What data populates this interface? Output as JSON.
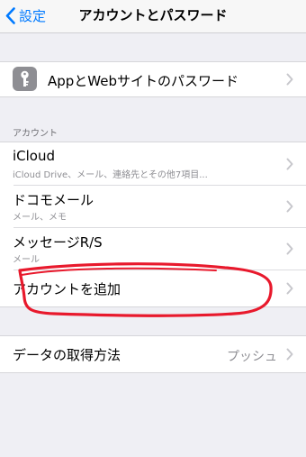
{
  "nav": {
    "back_label": "設定",
    "title": "アカウントとパスワード"
  },
  "passwords": {
    "label": "AppとWebサイトのパスワード",
    "icon": "key-icon"
  },
  "accounts_section": {
    "header": "アカウント",
    "items": [
      {
        "title": "iCloud",
        "subtitle": "iCloud Drive、メール、連絡先とその他7項目..."
      },
      {
        "title": "ドコモメール",
        "subtitle": "メール、メモ"
      },
      {
        "title": "メッセージR/S",
        "subtitle": "メール"
      }
    ],
    "add_account": "アカウントを追加"
  },
  "fetch": {
    "label": "データの取得方法",
    "value": "プッシュ"
  },
  "colors": {
    "accent": "#007aff",
    "annotation": "#e8192c"
  }
}
